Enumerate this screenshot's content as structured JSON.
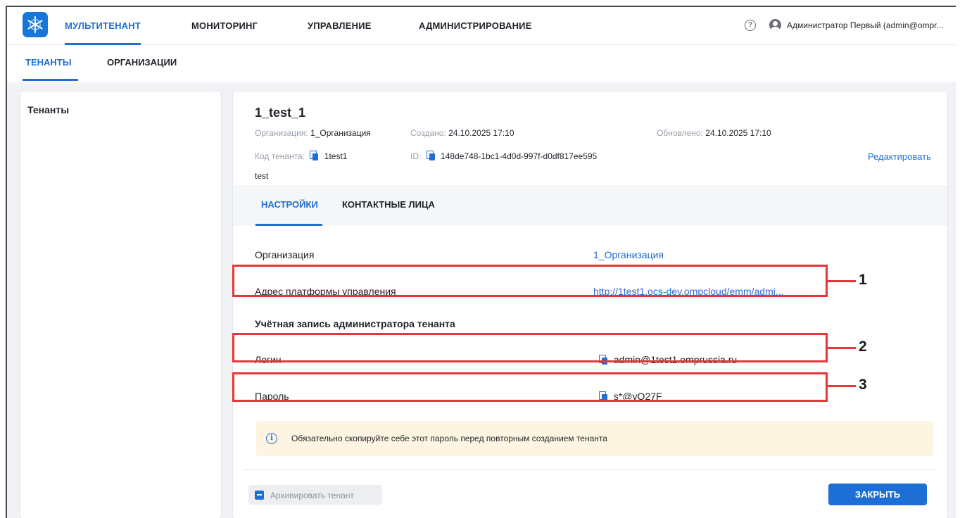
{
  "topnav": {
    "tabs": [
      {
        "label": "МУЛЬТИТЕНАНТ",
        "active": true
      },
      {
        "label": "МОНИТОРИНГ",
        "active": false
      },
      {
        "label": "УПРАВЛЕНИЕ",
        "active": false
      },
      {
        "label": "АДМИНИСТРИРОВАНИЕ",
        "active": false
      }
    ],
    "help_icon": "?",
    "user_name": "Администратор Первый (admin@ompr..."
  },
  "subnav": {
    "tabs": [
      {
        "label": "ТЕНАНТЫ",
        "active": true
      },
      {
        "label": "ОРГАНИЗАЦИИ",
        "active": false
      }
    ]
  },
  "left_panel": {
    "title": "Тенанты"
  },
  "tenant": {
    "name": "1_test_1",
    "org_label": "Организация:",
    "org_value": "1_Организация",
    "created_label": "Создано:",
    "created_value": "24.10.2025 17:10",
    "updated_label": "Обновлено:",
    "updated_value": "24.10.2025 17:10",
    "code_label": "Код тенанта:",
    "code_value": "1test1",
    "id_label": "ID:",
    "id_value": "148de748-1bc1-4d0d-997f-d0df817ee595",
    "edit_label": "Редактировать",
    "description": "test"
  },
  "inner_tabs": [
    {
      "label": "НАСТРОЙКИ",
      "active": true
    },
    {
      "label": "КОНТАКТНЫЕ ЛИЦА",
      "active": false
    }
  ],
  "settings": {
    "org_label": "Организация",
    "org_value": "1_Организация",
    "platform_label": "Адрес платформы управления",
    "platform_value": "http://1test1.ocs-dev.ompcloud/emm/admi...",
    "admin_section": "Учётная запись администратора тенанта",
    "login_label": "Логин",
    "login_value": "admin@1test1.omprussia.ru",
    "password_label": "Пароль",
    "password_value": "s*@yQ27F",
    "notice_icon": "i",
    "notice": "Обязательно скопируйте себе этот пароль перед повторным созданием тенанта"
  },
  "footer": {
    "archive_label": "Архивировать тенант",
    "close_label": "ЗАКРЫТЬ"
  },
  "annotations": [
    "1",
    "2",
    "3"
  ],
  "colors": {
    "accent": "#1d6fd6",
    "annotation": "#e8353b",
    "notice_bg": "#fdf5e1",
    "page_bg": "#f0f2f5"
  }
}
